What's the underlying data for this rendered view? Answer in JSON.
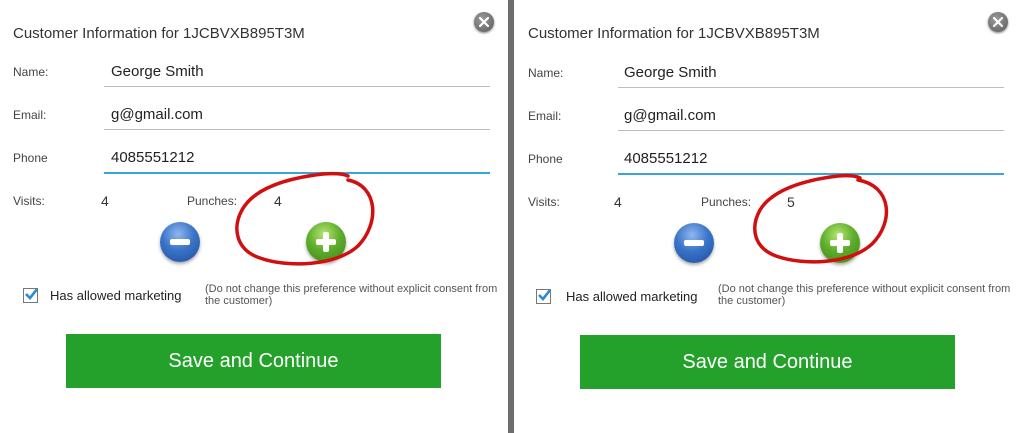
{
  "panels": [
    {
      "title": "Customer Information for 1JCBVXB895T3M",
      "name_label": "Name:",
      "name_value": "George Smith",
      "email_label": "Email:",
      "email_value": "g@gmail.com",
      "phone_label": "Phone",
      "phone_value": "4085551212",
      "visits_label": "Visits:",
      "visits_value": "4",
      "punches_label": "Punches:",
      "punches_value": "4",
      "marketing_checked": true,
      "marketing_label": "Has allowed marketing",
      "marketing_note": "(Do not change this preference without explicit consent from the customer)",
      "save_label": "Save and Continue"
    },
    {
      "title": "Customer Information for 1JCBVXB895T3M",
      "name_label": "Name:",
      "name_value": "George Smith",
      "email_label": "Email:",
      "email_value": "g@gmail.com",
      "phone_label": "Phone",
      "phone_value": "4085551212",
      "visits_label": "Visits:",
      "visits_value": "4",
      "punches_label": "Punches:",
      "punches_value": "5",
      "marketing_checked": true,
      "marketing_label": "Has allowed marketing",
      "marketing_note": "(Do not change this preference without explicit consent from the customer)",
      "save_label": "Save and Continue"
    }
  ],
  "colors": {
    "accent_blue": "#38a4d8",
    "save_green": "#23a12a",
    "annotation_red": "#d01010"
  },
  "icons": {
    "close": "close-icon",
    "minus": "minus-icon",
    "plus": "plus-icon",
    "check": "checkmark-icon"
  }
}
